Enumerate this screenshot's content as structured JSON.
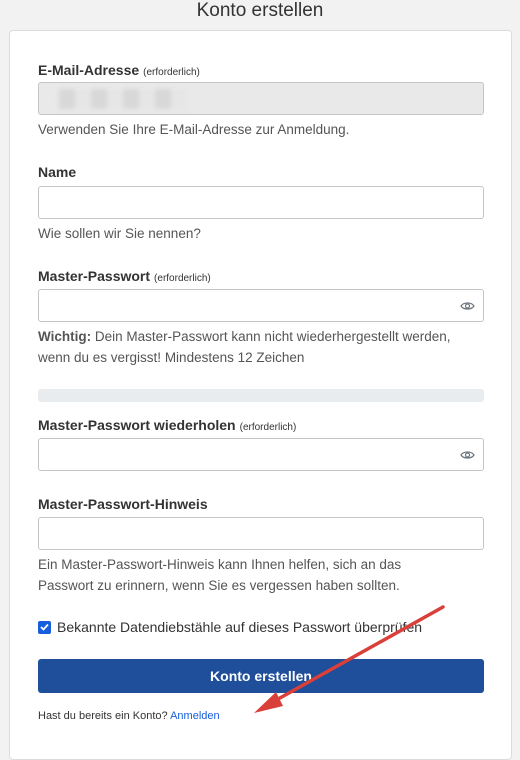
{
  "page": {
    "title": "Konto erstellen"
  },
  "email": {
    "label": "E-Mail-Adresse",
    "required": "(erforderlich)",
    "help": "Verwenden Sie Ihre E-Mail-Adresse zur Anmeldung."
  },
  "name": {
    "label": "Name",
    "help": "Wie sollen wir Sie nennen?"
  },
  "master_password": {
    "label": "Master-Passwort",
    "required": "(erforderlich)",
    "help_bold": "Wichtig:",
    "help_text": " Dein Master-Passwort kann nicht wiederhergestellt werden, wenn du es vergisst! Mindestens 12 Zeichen",
    "toggle_icon": "eye-icon"
  },
  "master_password_repeat": {
    "label": "Master-Passwort wiederholen",
    "required": "(erforderlich)",
    "toggle_icon": "eye-icon"
  },
  "hint": {
    "label": "Master-Passwort-Hinweis",
    "help": "Ein Master-Passwort-Hinweis kann Ihnen helfen, sich an das Passwort zu erinnern, wenn Sie es vergessen haben sollten."
  },
  "breach_check": {
    "label": "Bekannte Datendiebstähle auf dieses Passwort überprüfen",
    "checked": true
  },
  "submit": {
    "label": "Konto erstellen"
  },
  "footer": {
    "text": "Hast du bereits ein Konto? ",
    "link": "Anmelden"
  },
  "colors": {
    "accent": "#1f4e9a",
    "link": "#175ddc",
    "annotation_arrow": "#d9403a"
  }
}
